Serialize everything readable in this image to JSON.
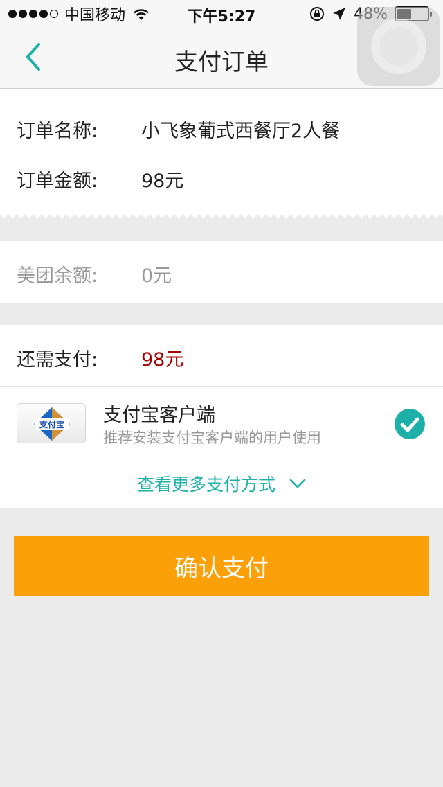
{
  "status_bar": {
    "carrier": "中国移动",
    "time": "下午5:27",
    "battery_percent_label": "48%",
    "battery_level": 0.48
  },
  "nav": {
    "title": "支付订单",
    "back_icon": "chevron-left-icon"
  },
  "order": {
    "name_label": "订单名称:",
    "name_value": "小飞象葡式西餐厅2人餐",
    "amount_label": "订单金额:",
    "amount_value": "98元"
  },
  "balance": {
    "label": "美团余额:",
    "value": "0元"
  },
  "payment": {
    "due_label": "还需支付:",
    "due_value": "98元",
    "method": {
      "logo_text": "支付宝",
      "name": "支付宝客户端",
      "description": "推荐安装支付宝客户端的用户使用",
      "selected": true
    },
    "more_label": "查看更多支付方式"
  },
  "confirm_label": "确认支付",
  "colors": {
    "accent": "#1cb0a8",
    "due_amount": "#a40000",
    "confirm_button": "#fba009",
    "background": "#ebebeb"
  }
}
